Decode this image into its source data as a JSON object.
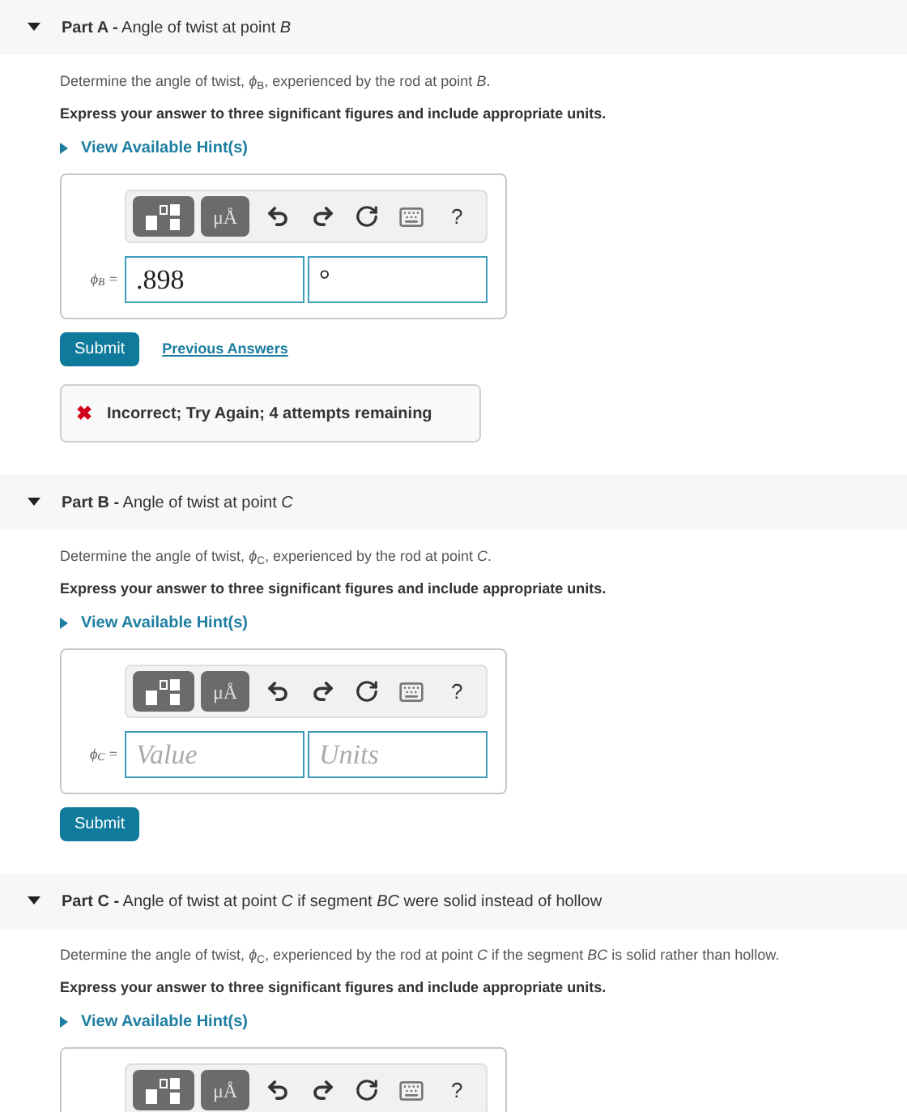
{
  "parts": [
    {
      "title": "**Part A -** Angle of twist at point *B*",
      "expanded": true,
      "prompt": "Determine the angle of twist, *ϕ*$_{B}$, experienced by the rod at point *B*.",
      "instruction": "Express your answer to three significant figures and include appropriate units.",
      "hint": "View Available Hint(s)",
      "toolbar": {
        "symbols": "μÅ",
        "help": "?"
      },
      "answer": {
        "label": "ϕ$_{B}$ =",
        "value": ".898",
        "units": "°"
      },
      "submit": "Submit",
      "previous_answers": "Previous Answers",
      "feedback": {
        "kind": "incorrect",
        "mark": "✖",
        "text": "Incorrect; Try Again; 4 attempts remaining"
      }
    },
    {
      "title": "**Part B -** Angle of twist at point *C*",
      "expanded": true,
      "prompt": "Determine the angle of twist, *ϕ*$_{C}$, experienced by the rod at point *C*.",
      "instruction": "Express your answer to three significant figures and include appropriate units.",
      "hint": "View Available Hint(s)",
      "toolbar": {
        "symbols": "μÅ",
        "help": "?"
      },
      "answer": {
        "label": "ϕ$_{C}$ =",
        "value_placeholder": "Value",
        "units_placeholder": "Units"
      },
      "submit": "Submit"
    },
    {
      "title": "**Part C -** Angle of twist at point *C* if segment *BC* were solid instead of hollow",
      "expanded": true,
      "prompt": "Determine the angle of twist, *ϕ*$_{C}$, experienced by the rod at point *C* if the segment *BC* is solid rather than hollow.",
      "instruction": "Express your answer to three significant figures and include appropriate units.",
      "hint": "View Available Hint(s)",
      "toolbar": {
        "symbols": "μÅ",
        "help": "?"
      }
    }
  ]
}
